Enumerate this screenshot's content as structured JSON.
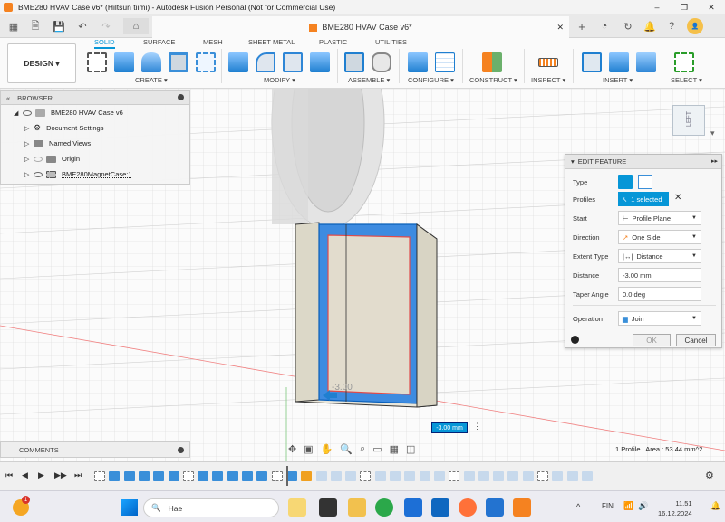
{
  "window": {
    "title": "BME280 HVAV Case v6* (Hiltsun tiimi) - Autodesk Fusion Personal (Not for Commercial Use)",
    "minimize": "–",
    "maximize": "❐",
    "close": "✕"
  },
  "tabbar": {
    "doc_tab": "BME280 HVAV Case v6*",
    "close_tab": "✕",
    "add_tab": "+"
  },
  "toolbar": {
    "design_label": "DESIGN ▾",
    "workspace_tabs": [
      "SOLID",
      "SURFACE",
      "MESH",
      "SHEET METAL",
      "PLASTIC",
      "UTILITIES"
    ],
    "groups": [
      "CREATE ▾",
      "MODIFY ▾",
      "ASSEMBLE ▾",
      "CONFIGURE ▾",
      "CONSTRUCT ▾",
      "INSPECT ▾",
      "INSERT ▾",
      "SELECT ▾"
    ]
  },
  "browser": {
    "title": "BROWSER",
    "items": [
      {
        "label": "BME280 HVAV Case v6"
      },
      {
        "label": "Document Settings"
      },
      {
        "label": "Named Views"
      },
      {
        "label": "Origin"
      },
      {
        "label": "BME280MagnetCase:1"
      }
    ]
  },
  "comments": {
    "label": "COMMENTS"
  },
  "edit_feature": {
    "title": "EDIT FEATURE",
    "type_label": "Type",
    "profiles_label": "Profiles",
    "profiles_value": "1 selected",
    "start_label": "Start",
    "start_value": "Profile Plane",
    "direction_label": "Direction",
    "direction_value": "One Side",
    "extent_label": "Extent Type",
    "extent_value": "Distance",
    "distance_label": "Distance",
    "distance_value": "-3.00 mm",
    "taper_label": "Taper Angle",
    "taper_value": "0.0 deg",
    "operation_label": "Operation",
    "operation_value": "Join",
    "ok": "OK",
    "cancel": "Cancel"
  },
  "viewport": {
    "dim_input": "-3.00 mm",
    "dim_ghost": "-3.00",
    "viewcube_label": "LEFT"
  },
  "status": {
    "text": "1 Profile | Area : 53.44 mm^2"
  },
  "taskbar": {
    "search_placeholder": "Hae",
    "lang": "FIN",
    "time": "11.51",
    "date": "16.12.2024",
    "badge": "1"
  }
}
